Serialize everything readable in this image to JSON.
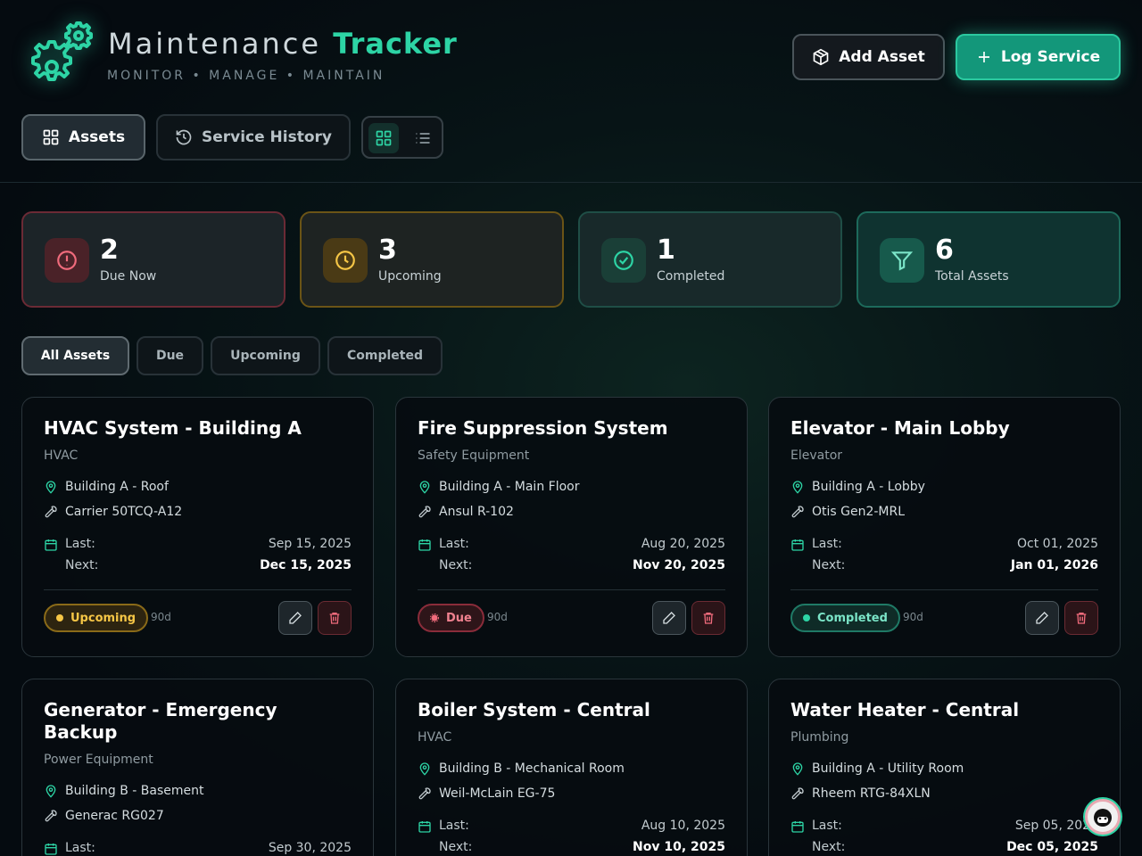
{
  "app": {
    "title_main": "Maintenance",
    "title_accent": "Tracker",
    "subtitle": "MONITOR • MANAGE • MAINTAIN",
    "accent_color": "#2dd4a5"
  },
  "header": {
    "add_asset_label": "Add Asset",
    "log_service_label": "Log Service"
  },
  "tabs": {
    "assets_label": "Assets",
    "history_label": "Service History"
  },
  "stats": [
    {
      "value": "2",
      "label": "Due Now",
      "icon": "alert-circle-icon"
    },
    {
      "value": "3",
      "label": "Upcoming",
      "icon": "clock-icon"
    },
    {
      "value": "1",
      "label": "Completed",
      "icon": "check-circle-icon"
    },
    {
      "value": "6",
      "label": "Total Assets",
      "icon": "filter-icon"
    }
  ],
  "filters": [
    "All Assets",
    "Due",
    "Upcoming",
    "Completed"
  ],
  "labels": {
    "last": "Last:",
    "next": "Next:"
  },
  "assets": [
    {
      "name": "HVAC System - Building A",
      "category": "HVAC",
      "location": "Building A - Roof",
      "model": "Carrier 50TCQ-A12",
      "last": "Sep 15, 2025",
      "next": "Dec 15, 2025",
      "status": "Upcoming",
      "interval": "90d"
    },
    {
      "name": "Fire Suppression System",
      "category": "Safety Equipment",
      "location": "Building A - Main Floor",
      "model": "Ansul R-102",
      "last": "Aug 20, 2025",
      "next": "Nov 20, 2025",
      "status": "Due",
      "interval": "90d"
    },
    {
      "name": "Elevator - Main Lobby",
      "category": "Elevator",
      "location": "Building A - Lobby",
      "model": "Otis Gen2-MRL",
      "last": "Oct 01, 2025",
      "next": "Jan 01, 2026",
      "status": "Completed",
      "interval": "90d"
    },
    {
      "name": "Generator - Emergency Backup",
      "category": "Power Equipment",
      "location": "Building B - Basement",
      "model": "Generac RG027",
      "last": "Sep 30, 2025",
      "next": "",
      "status": "",
      "interval": ""
    },
    {
      "name": "Boiler System - Central",
      "category": "HVAC",
      "location": "Building B - Mechanical Room",
      "model": "Weil-McLain EG-75",
      "last": "Aug 10, 2025",
      "next": "Nov 10, 2025",
      "status": "",
      "interval": ""
    },
    {
      "name": "Water Heater - Central",
      "category": "Plumbing",
      "location": "Building A - Utility Room",
      "model": "Rheem RTG-84XLN",
      "last": "Sep 05, 2025",
      "next": "Dec 05, 2025",
      "status": "",
      "interval": ""
    }
  ]
}
